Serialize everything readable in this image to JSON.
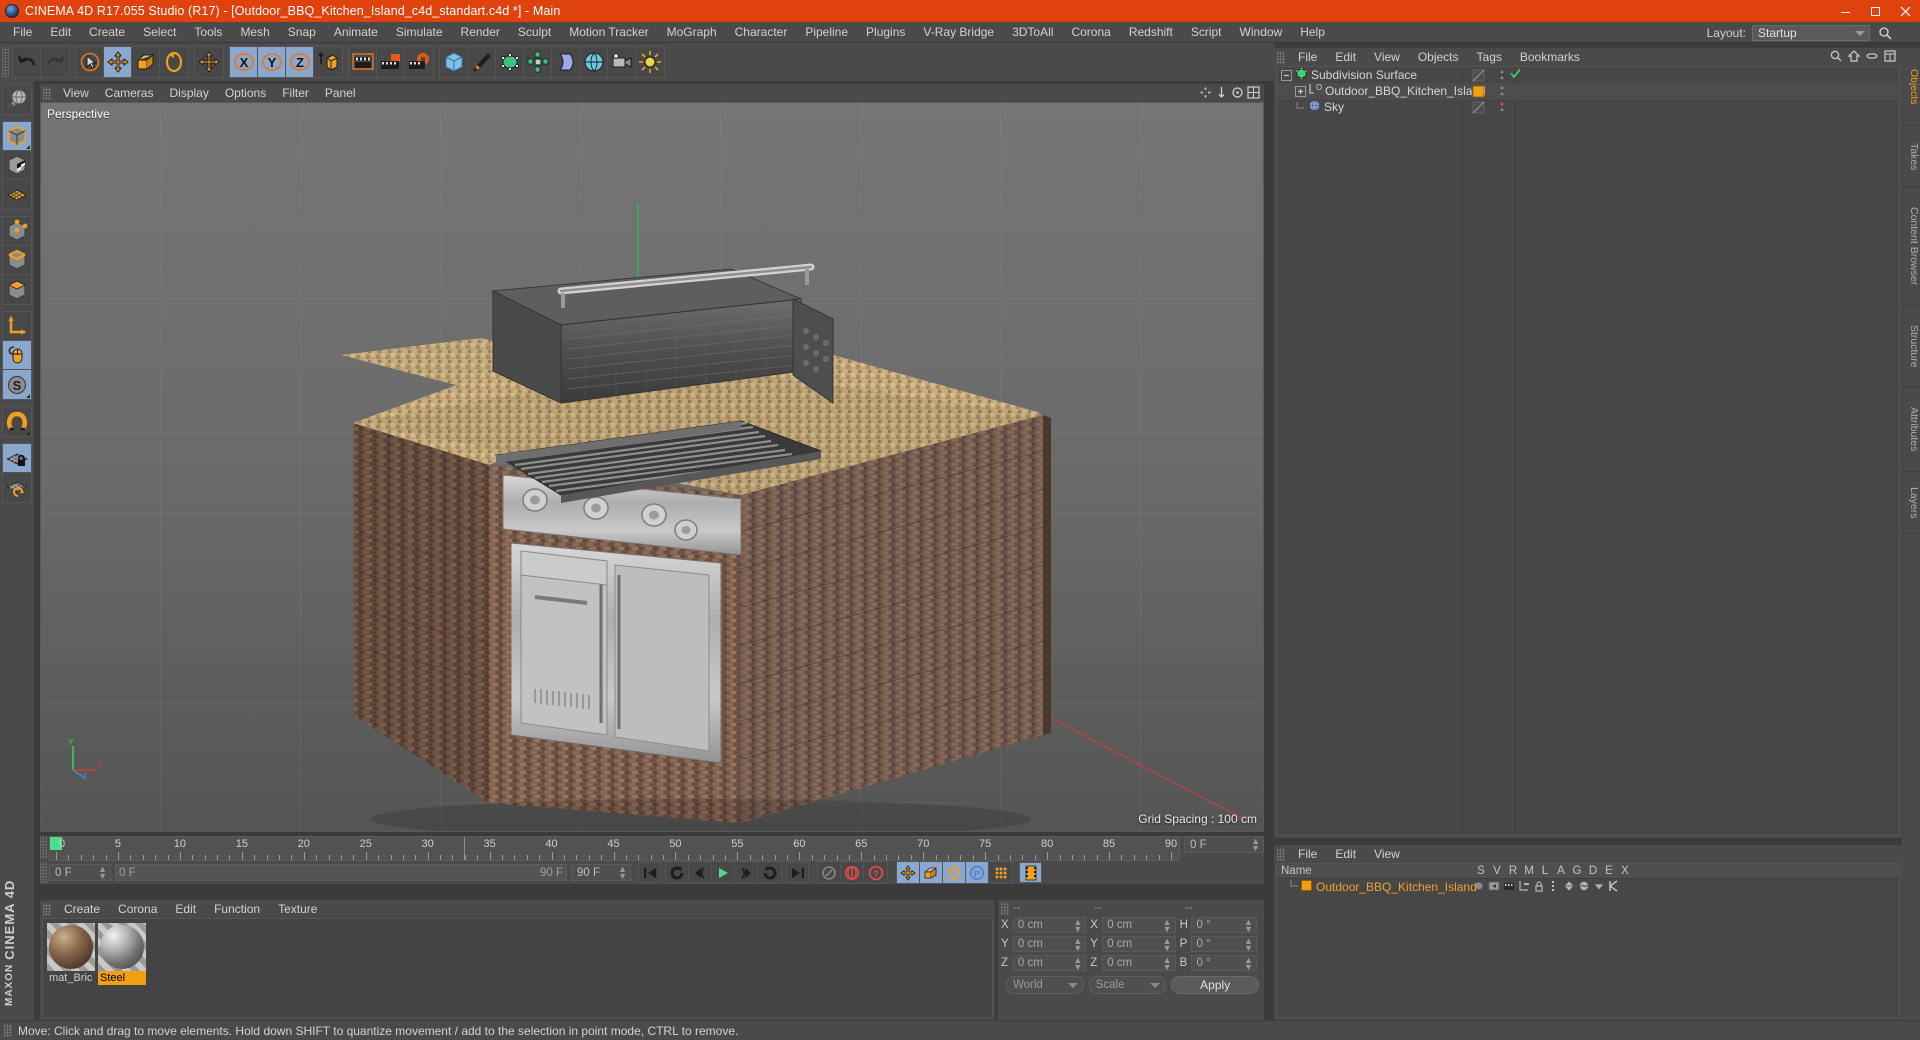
{
  "window": {
    "title": "CINEMA 4D R17.055 Studio (R17) - [Outdoor_BBQ_Kitchen_Island_c4d_standart.c4d *] - Main",
    "accent_color": "#e0420d",
    "buttons": [
      "minimize",
      "maximize",
      "close"
    ]
  },
  "menubar": {
    "items": [
      "File",
      "Edit",
      "Create",
      "Select",
      "Tools",
      "Mesh",
      "Snap",
      "Animate",
      "Simulate",
      "Render",
      "Sculpt",
      "Motion Tracker",
      "MoGraph",
      "Character",
      "Pipeline",
      "Plugins",
      "V-Ray Bridge",
      "3DToAll",
      "Corona",
      "Redshift",
      "Script",
      "Window",
      "Help"
    ],
    "layout_label": "Layout:",
    "layout_value": "Startup"
  },
  "toolbar": {
    "groups": [
      {
        "name": "history",
        "buttons": [
          {
            "icon": "undo-icon",
            "active": false,
            "dim": false
          },
          {
            "icon": "redo-icon",
            "active": false,
            "dim": true
          }
        ]
      },
      {
        "name": "transform",
        "buttons": [
          {
            "icon": "select-live-icon",
            "active": false,
            "dim": false
          },
          {
            "icon": "move-icon",
            "active": true,
            "dim": false
          },
          {
            "icon": "scale-icon",
            "active": false,
            "dim": false
          },
          {
            "icon": "rotate-icon",
            "active": false,
            "dim": false
          }
        ]
      },
      {
        "name": "axis-lock-extra",
        "buttons": [
          {
            "icon": "move-axis-icon",
            "active": false,
            "dim": false
          }
        ]
      },
      {
        "name": "axis",
        "buttons": [
          {
            "icon": "x-axis-icon",
            "active": true,
            "dim": false
          },
          {
            "icon": "y-axis-icon",
            "active": true,
            "dim": false
          },
          {
            "icon": "z-axis-icon",
            "active": true,
            "dim": false
          },
          {
            "icon": "world-coordinates-icon",
            "active": false,
            "dim": false
          }
        ]
      },
      {
        "name": "render",
        "buttons": [
          {
            "icon": "render-view-icon",
            "active": false,
            "dim": false
          },
          {
            "icon": "render-to-picture-viewer-icon",
            "active": false,
            "dim": false
          },
          {
            "icon": "render-settings-icon",
            "active": false,
            "dim": false
          }
        ]
      },
      {
        "name": "objects",
        "buttons": [
          {
            "icon": "cube-primitive-icon",
            "active": false,
            "dim": false
          },
          {
            "icon": "spline-pen-icon",
            "active": false,
            "dim": false
          },
          {
            "icon": "generator-nurbs-icon",
            "active": false,
            "dim": false
          },
          {
            "icon": "array-modeling-icon",
            "active": false,
            "dim": false
          },
          {
            "icon": "deformer-bend-icon",
            "active": false,
            "dim": false
          },
          {
            "icon": "environment-floor-icon",
            "active": false,
            "dim": false
          },
          {
            "icon": "camera-icon",
            "active": false,
            "dim": false
          },
          {
            "icon": "light-icon",
            "active": false,
            "dim": false
          }
        ]
      }
    ]
  },
  "left_palette": {
    "groups": [
      {
        "buttons": [
          {
            "icon": "make-editable-icon",
            "active": false
          }
        ]
      },
      {
        "buttons": [
          {
            "icon": "model-mode-icon",
            "active": true
          },
          {
            "icon": "texture-mode-icon",
            "active": false
          },
          {
            "icon": "polygon-mode-icon",
            "active": false
          }
        ]
      },
      {
        "buttons": [
          {
            "icon": "points-mode-icon",
            "active": false
          },
          {
            "icon": "edges-mode-icon",
            "active": false
          },
          {
            "icon": "polygons-mode-icon",
            "active": false
          }
        ]
      },
      {
        "buttons": [
          {
            "icon": "object-axis-icon",
            "active": false
          },
          {
            "icon": "viewport-solo-icon",
            "active": true
          },
          {
            "icon": "enable-snap-s-icon",
            "active": true
          }
        ]
      },
      {
        "buttons": [
          {
            "icon": "magnet-tool-icon",
            "active": false
          }
        ]
      },
      {
        "buttons": [
          {
            "icon": "workplane-lock-icon",
            "active": true
          },
          {
            "icon": "workplane-rotate-icon",
            "active": false
          }
        ]
      }
    ],
    "brand_line1": "MAXON",
    "brand_line2": "CINEMA 4D"
  },
  "viewport": {
    "menu": [
      "View",
      "Cameras",
      "Display",
      "Options",
      "Filter",
      "Panel"
    ],
    "camera_label": "Perspective",
    "grid_spacing": "Grid Spacing : 100 cm",
    "axis_labels": {
      "x": "X",
      "y": "Y",
      "z": "Z"
    }
  },
  "timeline": {
    "tick_labels": [
      "0",
      "5",
      "10",
      "15",
      "20",
      "25",
      "30",
      "35",
      "40",
      "45",
      "50",
      "55",
      "60",
      "65",
      "70",
      "75",
      "80",
      "85",
      "90"
    ],
    "current_frame": "0 F",
    "range_start": "0 F",
    "range_end": "90 F",
    "preview_end": "90 F",
    "document_frame": "0 F",
    "transport": [
      {
        "icon": "go-to-start-icon"
      },
      {
        "icon": "play-backwards-loop-icon"
      },
      {
        "icon": "previous-frame-icon"
      },
      {
        "icon": "play-forward-icon"
      },
      {
        "icon": "next-frame-icon"
      },
      {
        "icon": "loop-playback-icon"
      },
      {
        "icon": "go-to-end-icon"
      }
    ],
    "key_buttons": [
      {
        "icon": "autokeying-icon",
        "active": false
      },
      {
        "icon": "record-active-objects-icon",
        "active": false
      },
      {
        "icon": "key-selection-icon",
        "active": false
      }
    ],
    "record_toggles": [
      {
        "icon": "record-position-icon",
        "active": true
      },
      {
        "icon": "record-scale-icon",
        "active": true
      },
      {
        "icon": "record-rotation-icon",
        "active": true
      },
      {
        "icon": "record-parameter-icon",
        "active": true
      },
      {
        "icon": "record-pla-icon",
        "active": false
      }
    ],
    "extra": [
      {
        "icon": "timeline-filmstrip-icon",
        "active": true
      }
    ]
  },
  "material_manager": {
    "menu": [
      "Create",
      "Corona",
      "Edit",
      "Function",
      "Texture"
    ],
    "materials": [
      {
        "name": "mat_Bric",
        "selected": false,
        "swatch_type": "brick"
      },
      {
        "name": "Steel",
        "selected": true,
        "swatch_type": "steel"
      }
    ]
  },
  "coordinate_manager": {
    "headers": [
      "--",
      "--",
      "--"
    ],
    "rows": [
      {
        "left_axis": "X",
        "left_value": "0 cm",
        "mid_axis": "X",
        "mid_value": "0 cm",
        "right_axis": "H",
        "right_value": "0 °"
      },
      {
        "left_axis": "Y",
        "left_value": "0 cm",
        "mid_axis": "Y",
        "mid_value": "0 cm",
        "right_axis": "P",
        "right_value": "0 °"
      },
      {
        "left_axis": "Z",
        "left_value": "0 cm",
        "mid_axis": "Z",
        "mid_value": "0 cm",
        "right_axis": "B",
        "right_value": "0 °"
      }
    ],
    "system": "World",
    "mode": "Scale",
    "apply_label": "Apply"
  },
  "object_manager": {
    "menu": [
      "File",
      "Edit",
      "View",
      "Objects",
      "Tags",
      "Bookmarks"
    ],
    "tools": [
      "search-icon",
      "home-icon",
      "layer-icon",
      "expand-icon"
    ],
    "objects": [
      {
        "label": "Subdivision Surface",
        "icon": "subdivision-surface-icon",
        "indent": 0,
        "tag": "none",
        "visible_dot": "check",
        "expander": "minus"
      },
      {
        "label": "Outdoor_BBQ_Kitchen_Island",
        "icon": "null-object-icon",
        "indent": 1,
        "tag": "material-tag",
        "visible_dot": "dots",
        "expander": "plus"
      },
      {
        "label": "Sky",
        "icon": "sky-object-icon",
        "indent": 1,
        "tag": "none",
        "visible_dot": "red",
        "expander": "none"
      }
    ]
  },
  "attribute_panel": {
    "menu": [
      "File",
      "Edit",
      "View"
    ],
    "columns": [
      "Name",
      "S",
      "V",
      "R",
      "M",
      "L",
      "A",
      "G",
      "D",
      "E",
      "X"
    ],
    "rows": [
      {
        "name": "Outdoor_BBQ_Kitchen_Island",
        "color": "#f2a010",
        "icons": [
          "sphere-dot-icon",
          "visibility-icon",
          "render-icon",
          "hierarchy-icon",
          "lock-icon",
          "animation-icon",
          "generator-icon",
          "deformer-icon",
          "cap-icon",
          "knife-icon"
        ]
      }
    ]
  },
  "right_tabs": [
    {
      "label": "Objects",
      "accent": true
    },
    {
      "label": "Takes",
      "accent": false
    },
    {
      "label": "Content Browser",
      "accent": false
    },
    {
      "label": "Structure",
      "accent": false
    },
    {
      "label": "Attributes",
      "accent": false
    },
    {
      "label": "Layers",
      "accent": false
    }
  ],
  "statusbar": {
    "message": "Move: Click and drag to move elements. Hold down SHIFT to quantize movement / add to the selection in point mode, CTRL to remove."
  }
}
